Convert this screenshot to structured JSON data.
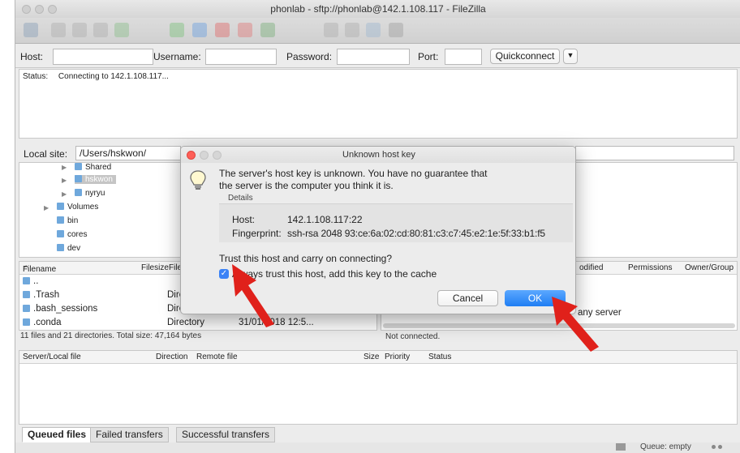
{
  "window": {
    "title": "phonlab - sftp://phonlab@142.1.108.117 - FileZilla"
  },
  "quickconnect": {
    "host_label": "Host:",
    "username_label": "Username:",
    "password_label": "Password:",
    "port_label": "Port:",
    "quickconnect_label": "Quickconnect"
  },
  "log": {
    "label": "Status:",
    "message": "Connecting to 142.1.108.117..."
  },
  "local": {
    "site_label": "Local site:",
    "site_path": "/Users/hskwon/",
    "tree": [
      "Shared",
      "hskwon",
      "nyryu",
      "Volumes",
      "bin",
      "cores",
      "dev"
    ],
    "columns": {
      "filename": "Filename",
      "filesize": "Filesize",
      "filetype": "Filet"
    },
    "files": [
      {
        "name": "..",
        "type": "",
        "modified": ""
      },
      {
        "name": ".Trash",
        "type": "Dire",
        "modified": ""
      },
      {
        "name": ".bash_sessions",
        "type": "Dire",
        "modified": ""
      },
      {
        "name": ".conda",
        "type": "Directory",
        "modified": "31/01/2018 12:5..."
      }
    ],
    "summary": "11 files and 21 directories. Total size: 47,164 bytes"
  },
  "remote": {
    "columns": {
      "modified": "odified",
      "permissions": "Permissions",
      "owner": "Owner/Group"
    },
    "message": "any server",
    "status": "Not connected."
  },
  "queue": {
    "columns": {
      "server_local": "Server/Local file",
      "direction": "Direction",
      "remote": "Remote file",
      "size": "Size",
      "priority": "Priority",
      "status": "Status"
    },
    "tabs": [
      "Queued files",
      "Failed transfers",
      "Successful transfers"
    ],
    "queue_status": "Queue: empty"
  },
  "dialog": {
    "title": "Unknown host key",
    "message_line1": "The server's host key is unknown. You have no guarantee that",
    "message_line2": "the server is the computer you think it is.",
    "details_label": "Details",
    "host_key": "Host:",
    "host_value": "142.1.108.117:22",
    "fingerprint_key": "Fingerprint:",
    "fingerprint_value": "ssh-rsa 2048 93:ce:6a:02:cd:80:81:c3:c7:45:e2:1e:5f:33:b1:f5",
    "question": "Trust this host and carry on connecting?",
    "checkbox_label": "Always trust this host, add this key to the cache",
    "checkbox_checked": true,
    "cancel_label": "Cancel",
    "ok_label": "OK"
  },
  "colors": {
    "accent": "#1f7ef3",
    "arrow": "#e0211b",
    "close": "#fe5f57"
  }
}
